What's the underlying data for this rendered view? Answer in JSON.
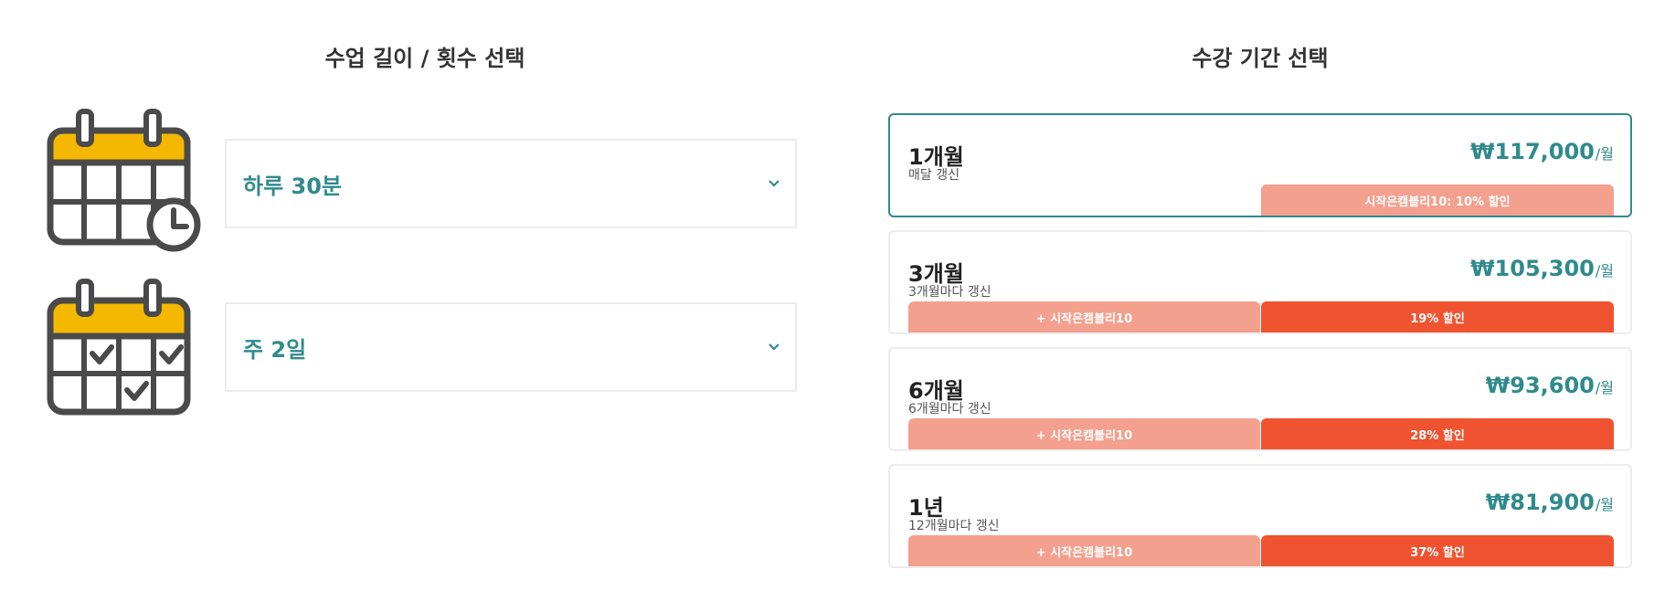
{
  "left": {
    "title": "수업 길이 / 횟수 선택",
    "icons": [
      "calendar-clock-icon",
      "calendar-check-icon"
    ],
    "duration": {
      "value": "하루 30분"
    },
    "frequency": {
      "value": "주 2일"
    }
  },
  "right": {
    "title": "수강 기간 선택",
    "plans": [
      {
        "name": "1개월",
        "renew": "매달 갱신",
        "price": "₩117,000",
        "unit": "/월",
        "coupon": "시작은캠블리10: 10% 할인",
        "selected": true
      },
      {
        "name": "3개월",
        "renew": "3개월마다 갱신",
        "price": "₩105,300",
        "unit": "/월",
        "coupon": "+ 시작은캠블리10",
        "discount": "19% 할인"
      },
      {
        "name": "6개월",
        "renew": "6개월마다 갱신",
        "price": "₩93,600",
        "unit": "/월",
        "coupon": "+ 시작은캠블리10",
        "discount": "28% 할인"
      },
      {
        "name": "1년",
        "renew": "12개월마다 갱신",
        "price": "₩81,900",
        "unit": "/월",
        "coupon": "+ 시작은캠블리10",
        "discount": "37% 할인"
      }
    ]
  },
  "colors": {
    "accent": "#2f8a8d",
    "selected_border": "#2e8b8f",
    "coupon_bar": "#f4a08e",
    "discount_bar": "#ef5330",
    "calendar_header": "#f5b800",
    "icon_stroke": "#4a4a4a"
  }
}
